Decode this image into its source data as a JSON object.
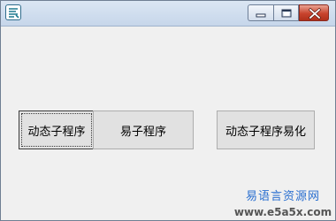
{
  "window": {
    "icon": "easy-language-app-icon",
    "controls": {
      "minimize_icon": "minimize-icon",
      "maximize_icon": "maximize-icon",
      "close_icon": "close-icon",
      "close_color": "#c8432d"
    }
  },
  "buttons": [
    {
      "label": "动态子程序",
      "focused": true
    },
    {
      "label": "易子程序",
      "focused": false
    },
    {
      "label": "动态子程序易化",
      "focused": false
    }
  ],
  "watermark": {
    "title": "易语言资源网",
    "url": "www.e5a5x.com",
    "title_color": "#2a6fd0"
  }
}
